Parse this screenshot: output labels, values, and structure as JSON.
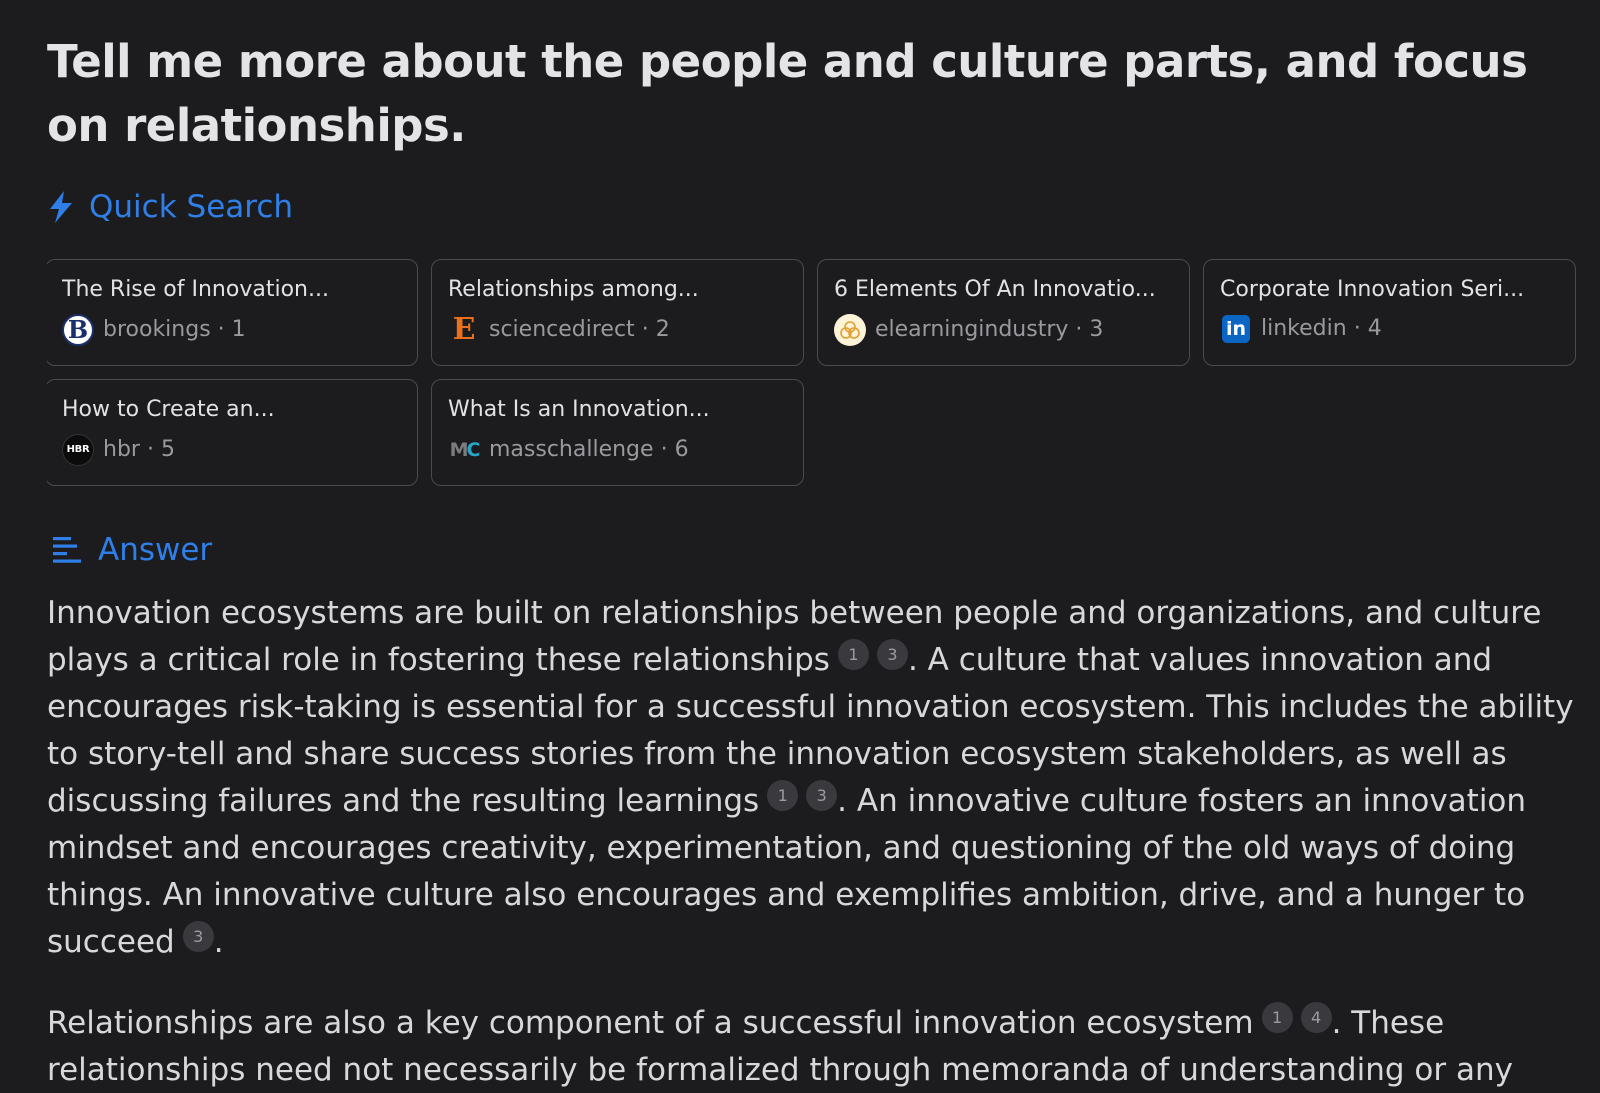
{
  "query": {
    "title": "Tell me more about the people and culture parts, and focus on relationships."
  },
  "quick_search": {
    "label": "Quick Search",
    "icon": "lightning-bolt-icon",
    "accent_color": "#2f7fe8",
    "sources": [
      {
        "title": "The Rise of Innovation...",
        "site": "brookings",
        "index": "1",
        "favicon": "brookings-icon",
        "favicon_text": "B"
      },
      {
        "title": "Relationships among...",
        "site": "sciencedirect",
        "index": "2",
        "favicon": "sciencedirect-icon",
        "favicon_text": "E"
      },
      {
        "title": "6 Elements Of An Innovatio...",
        "site": "elearningindustry",
        "index": "3",
        "favicon": "elearningindustry-icon",
        "favicon_text": ""
      },
      {
        "title": "Corporate Innovation Seri...",
        "site": "linkedin",
        "index": "4",
        "favicon": "linkedin-icon",
        "favicon_text": "in"
      },
      {
        "title": "How to Create an...",
        "site": "hbr",
        "index": "5",
        "favicon": "hbr-icon",
        "favicon_text": "HBR"
      },
      {
        "title": "What Is an Innovation...",
        "site": "masschallenge",
        "index": "6",
        "favicon": "masschallenge-icon",
        "favicon_text": "MC"
      }
    ]
  },
  "answer": {
    "label": "Answer",
    "icon": "answer-lines-icon",
    "paragraphs": [
      {
        "segments": [
          {
            "text": "Innovation ecosystems are built on relationships between people and organizations, and culture plays a critical role in fostering these relationships",
            "cites": [
              "1",
              "3"
            ]
          },
          {
            "text": ". A culture that values innovation and encourages risk-taking is essential for a successful innovation ecosystem. This includes the ability to story-tell and share success stories from the innovation ecosystem stakeholders, as well as discussing failures and the resulting learnings",
            "cites": [
              "1",
              "3"
            ]
          },
          {
            "text": ". An innovative culture fosters an innovation mindset and encourages creativity, experimentation, and questioning of the old ways of doing things. An innovative culture also encourages and exemplifies ambition, drive, and a hunger to succeed",
            "cites": [
              "3"
            ]
          },
          {
            "text": ".",
            "cites": []
          }
        ]
      },
      {
        "segments": [
          {
            "text": "Relationships are also a key component of a successful innovation ecosystem",
            "cites": [
              "1",
              "4"
            ]
          },
          {
            "text": ". These relationships need not necessarily be formalized through memoranda of understanding or any other kind of agreement",
            "cites": []
          }
        ]
      }
    ]
  }
}
